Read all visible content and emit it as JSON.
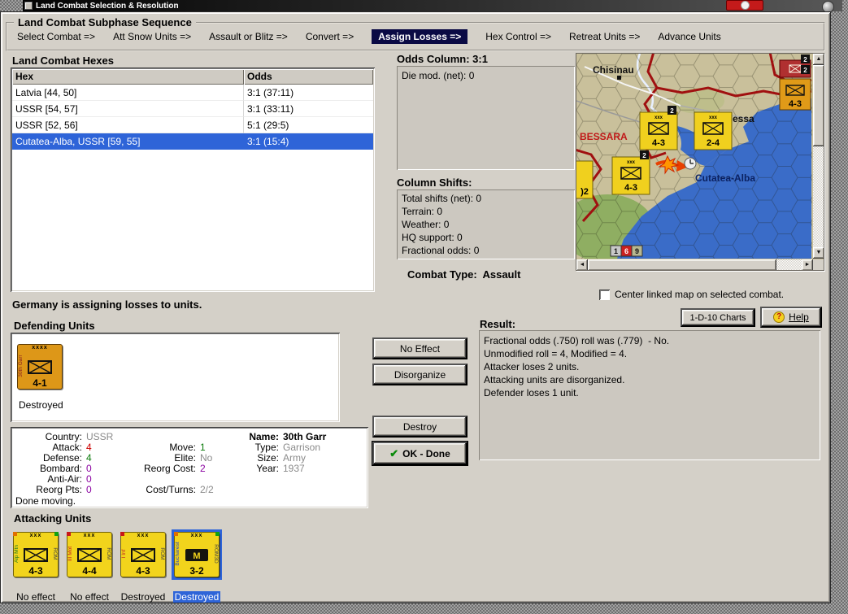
{
  "colors": {
    "dialog_bg": "#d4d0c8",
    "highlight_blue": "#2e64d8",
    "active_step_bg": "#0a0a44",
    "counter_yellow": "#f2d41c",
    "counter_orange": "#dd9718",
    "sea_blue": "#3a6cc8",
    "border_red": "#a01010",
    "stat_attack_red": "#cc0000",
    "stat_defense_green": "#0a7a0a",
    "stat_reorg_purple": "#8a00a0",
    "stat_muted_gray": "#8a8a8a"
  },
  "icons": {
    "scroll_up": "▲",
    "scroll_down": "▼",
    "scroll_left": "◄",
    "scroll_right": "►",
    "check": "✔",
    "help": "?",
    "militia": "M"
  },
  "window": {
    "title": "Land Combat Selection & Resolution"
  },
  "subphase": {
    "title": "Land Combat Subphase Sequence",
    "steps": [
      {
        "label": "Select Combat =>",
        "active": false
      },
      {
        "label": "Att Snow Units =>",
        "active": false
      },
      {
        "label": "Assault or Blitz =>",
        "active": false
      },
      {
        "label": "Convert =>",
        "active": false
      },
      {
        "label": "Assign Losses =>",
        "active": true
      },
      {
        "label": "Hex Control =>",
        "active": false
      },
      {
        "label": "Retreat Units =>",
        "active": false
      },
      {
        "label": "Advance Units",
        "active": false
      }
    ]
  },
  "hexes": {
    "title": "Land Combat Hexes",
    "columns": {
      "hex": "Hex",
      "odds": "Odds"
    },
    "rows": [
      {
        "hex": "Latvia [44, 50]",
        "odds": "3:1 (37:11)",
        "selected": false
      },
      {
        "hex": "USSR [54, 57]",
        "odds": "3:1 (33:11)",
        "selected": false
      },
      {
        "hex": "USSR [52, 56]",
        "odds": "5:1 (29:5)",
        "selected": false
      },
      {
        "hex": "Cutatea-Alba, USSR [59, 55]",
        "odds": "3:1 (15:4)",
        "selected": true
      }
    ]
  },
  "odds_panel": {
    "title": "Odds Column: 3:1",
    "die_mod": "Die mod. (net): 0"
  },
  "shifts_panel": {
    "title": "Column Shifts:",
    "lines": [
      "Total shifts (net): 0",
      "Terrain: 0",
      "Weather: 0",
      "HQ support: 0",
      "Fractional odds: 0"
    ]
  },
  "combat_type": {
    "label": "Combat Type:",
    "value": "Assault"
  },
  "map": {
    "labels": {
      "city_top": "Chisinau",
      "region": "BESSARA",
      "city_right": "essa",
      "coastal_city": "Cutatea-Alba"
    },
    "counters": [
      {
        "top": "xxx",
        "strength": "4-3"
      },
      {
        "top": "xxx",
        "strength": "2-4"
      },
      {
        "top": "xxx",
        "strength": "4-3"
      },
      {
        "top": "",
        "strength": ")2"
      },
      {
        "top": "",
        "strength": "4-3"
      }
    ],
    "badges": [
      "2",
      "2",
      "2",
      "2"
    ],
    "coord_cells": [
      "1",
      "6",
      "9"
    ]
  },
  "map_options": {
    "center_checkbox_label": "Center linked map on selected combat.",
    "checked": false
  },
  "toolbar": {
    "charts_button": "1-D-10 Charts",
    "help_button": "Help"
  },
  "status": {
    "assign_text": "Germany is assigning losses to units."
  },
  "defending": {
    "title": "Defending Units",
    "unit": {
      "top": "xxxx",
      "side_left": "30th Garr",
      "strength": "4-1",
      "result": "Destroyed"
    }
  },
  "unit_info": {
    "country_label": "Country:",
    "country": "USSR",
    "attack_label": "Attack:",
    "attack": "4",
    "defense_label": "Defense:",
    "defense": "4",
    "bombard_label": "Bombard:",
    "bombard": "0",
    "antiair_label": "Anti-Air:",
    "antiair": "0",
    "reorgpts_label": "Reorg Pts:",
    "reorgpts": "0",
    "move_label": "Move:",
    "move": "1",
    "elite_label": "Elite:",
    "elite": "No",
    "reorgcost_label": "Reorg Cost:",
    "reorgcost": "2",
    "costturns_label": "Cost/Turns:",
    "costturns": "2/2",
    "name_label": "Name:",
    "name": "30th Garr",
    "type_label": "Type:",
    "type": "Garrison",
    "size_label": "Size:",
    "size": "Army",
    "year_label": "Year:",
    "year": "1937",
    "status": "Done moving."
  },
  "actions": {
    "no_effect": "No Effect",
    "disorganize": "Disorganize",
    "destroy": "Destroy",
    "ok_done": "OK - Done"
  },
  "result": {
    "title": "Result:",
    "lines": [
      "Fractional odds (.750) roll was (.779)  - No.",
      "Unmodified roll = 4, Modified = 4.",
      "Attacker loses 2 units.",
      "Attacking units are disorganized.",
      "Defender loses 1 unit."
    ]
  },
  "attacking": {
    "title": "Attacking Units",
    "units": [
      {
        "top": "xxx",
        "side_left": "Alp Mtn",
        "side_right": "ROM",
        "strength": "4-3",
        "result": "No effect",
        "selected": false
      },
      {
        "top": "xxx",
        "side_left": "III Mot",
        "side_right": "ROM",
        "strength": "4-4",
        "result": "No effect",
        "selected": false
      },
      {
        "top": "xxx",
        "side_left": "I Inf",
        "side_right": "ROM",
        "strength": "4-3",
        "result": "Destroyed",
        "selected": false
      },
      {
        "top": "xxx",
        "side_left": "Bucharest",
        "side_right": "ROM3D",
        "strength": "3-2",
        "result": "Destroyed",
        "selected": true
      }
    ]
  }
}
